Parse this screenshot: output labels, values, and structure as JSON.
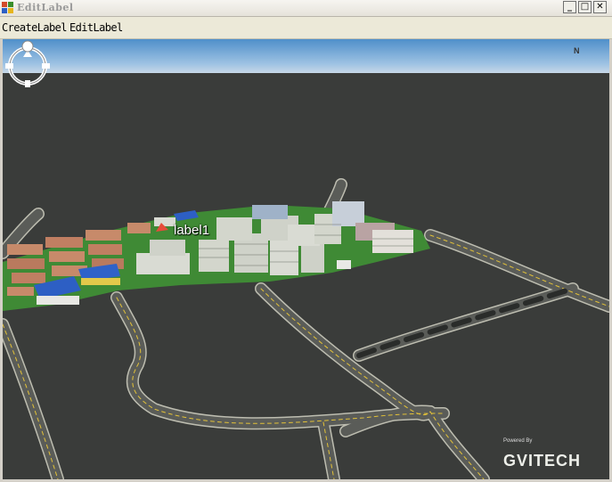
{
  "window": {
    "title": "EditLabel",
    "icon": "app-window-icon",
    "controls": {
      "minimize": "_",
      "maximize": "□",
      "close": "✕"
    }
  },
  "menu": {
    "items": [
      {
        "label": "CreateLabel"
      },
      {
        "label": "EditLabel"
      }
    ]
  },
  "scene": {
    "label_text": "label1",
    "compass_letter": "N",
    "powered_by": "Powered By",
    "logo_text": "GVITECH"
  },
  "colors": {
    "sky_top": "#4f8fca",
    "ground": "#3a3c3a",
    "road": "#5d5f5b",
    "road_edge": "#bdbdb0",
    "lane_mark": "#e3c238",
    "grass": "#3f8a35"
  }
}
